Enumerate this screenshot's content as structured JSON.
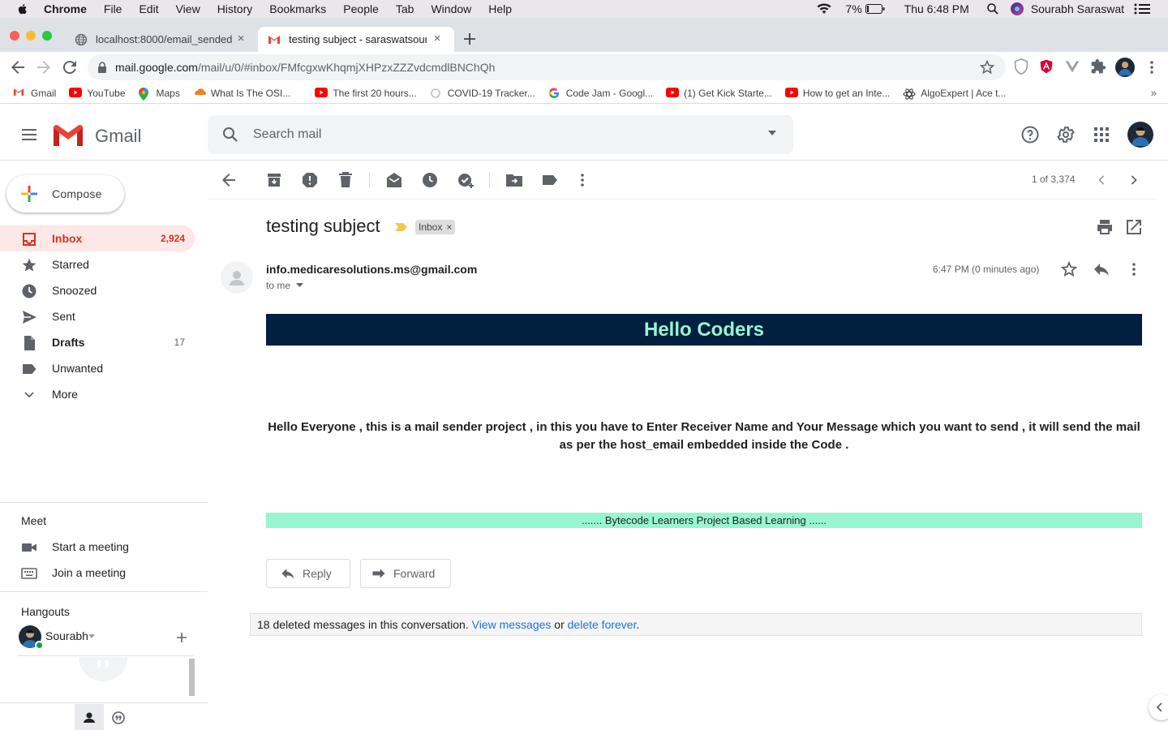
{
  "menubar": {
    "app": "Chrome",
    "items": [
      "File",
      "Edit",
      "View",
      "History",
      "Bookmarks",
      "People",
      "Tab",
      "Window",
      "Help"
    ],
    "battery": "7%",
    "clock": "Thu 6:48 PM",
    "user": "Sourabh Saraswat"
  },
  "tabs": [
    {
      "title": "localhost:8000/email_sended"
    },
    {
      "title": "testing subject - saraswatsour"
    }
  ],
  "omnibox": {
    "host": "mail.google.com",
    "path": "/mail/u/0/#inbox/FMfcgxwKhqmjXHPzxZZZvdcmdlBNChQh"
  },
  "bookmarks": [
    {
      "label": "Gmail"
    },
    {
      "label": "YouTube"
    },
    {
      "label": "Maps"
    },
    {
      "label": "What Is The OSI..."
    },
    {
      "label": "The first 20 hours..."
    },
    {
      "label": "COVID-19 Tracker..."
    },
    {
      "label": "Code Jam - Googl..."
    },
    {
      "label": "(1) Get Kick Starte..."
    },
    {
      "label": "How to get an Inte..."
    },
    {
      "label": "AlgoExpert | Ace t..."
    }
  ],
  "gmail": {
    "logo_text": "Gmail",
    "search_placeholder": "Search mail"
  },
  "sidebar": {
    "compose": "Compose",
    "items": [
      {
        "label": "Inbox",
        "count": "2,924"
      },
      {
        "label": "Starred",
        "count": ""
      },
      {
        "label": "Snoozed",
        "count": ""
      },
      {
        "label": "Sent",
        "count": ""
      },
      {
        "label": "Drafts",
        "count": "17"
      },
      {
        "label": "Unwanted",
        "count": ""
      },
      {
        "label": "More",
        "count": ""
      }
    ],
    "meet": {
      "title": "Meet",
      "start": "Start a meeting",
      "join": "Join a meeting"
    },
    "hangouts": {
      "title": "Hangouts",
      "user": "Sourabh"
    }
  },
  "toolbar": {
    "count": "1 of 3,374"
  },
  "message": {
    "subject": "testing subject",
    "label": "Inbox",
    "sender": "info.medicaresolutions.ms@gmail.com",
    "to": "to me",
    "time": "6:47 PM (0 minutes ago)",
    "banner": "Hello Coders",
    "body": "Hello Everyone , this is a mail sender project , in this you have to Enter Receiver Name and Your Message which you want to send , it will send the mail as per the host_email embedded inside the Code .",
    "footer": "....... Bytecode Learners Project Based Learning ......",
    "reply": "Reply",
    "forward": "Forward"
  },
  "deleted_notice": {
    "text": "18 deleted messages in this conversation. ",
    "view": "View messages",
    "or": " or ",
    "delete": "delete forever",
    "end": "."
  },
  "colors": {
    "banner_bg": "#011f3f",
    "banner_text": "#98f5d1",
    "footer_bg": "#98f5d1",
    "gmail_red": "#d93025",
    "link": "#1a73e8"
  }
}
